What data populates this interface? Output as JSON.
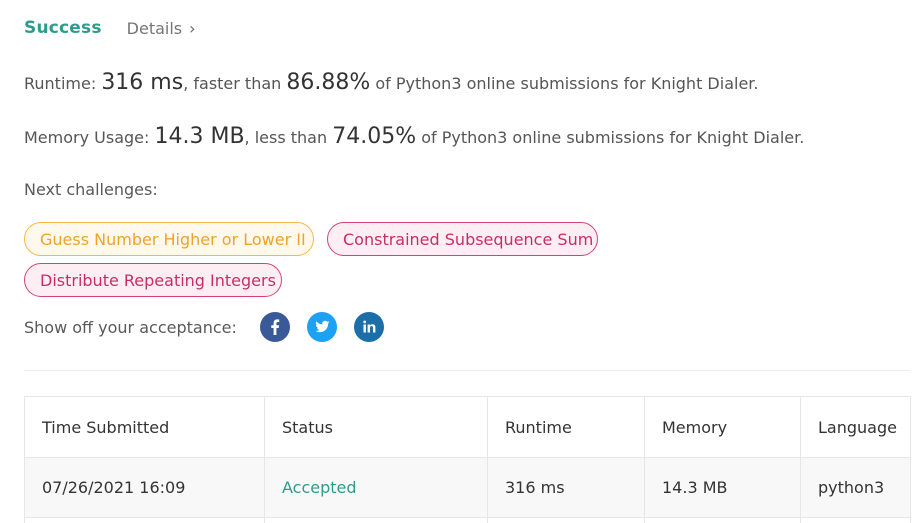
{
  "header": {
    "status": "Success",
    "details_label": "Details",
    "details_chevron": "›"
  },
  "runtime_line": {
    "label": "Runtime: ",
    "value": "316 ms",
    "mid": ", faster than ",
    "percent": "86.88%",
    "suffix": " of Python3 online submissions for Knight Dialer."
  },
  "memory_line": {
    "label": "Memory Usage: ",
    "value": "14.3 MB",
    "mid": ", less than ",
    "percent": "74.05%",
    "suffix": " of Python3 online submissions for Knight Dialer."
  },
  "next_challenges": {
    "label": "Next challenges:",
    "items": [
      {
        "label": "Guess Number Higher or Lower II",
        "difficulty": "medium"
      },
      {
        "label": "Constrained Subsequence Sum",
        "difficulty": "hard"
      },
      {
        "label": "Distribute Repeating Integers",
        "difficulty": "hard"
      }
    ]
  },
  "share": {
    "label": "Show off your acceptance:",
    "icons": [
      "facebook-icon",
      "twitter-icon",
      "linkedin-icon"
    ]
  },
  "table": {
    "headers": [
      "Time Submitted",
      "Status",
      "Runtime",
      "Memory",
      "Language"
    ],
    "rows": [
      {
        "time": "07/26/2021 16:09",
        "status": "Accepted",
        "runtime": "316 ms",
        "memory": "14.3 MB",
        "language": "python3"
      }
    ]
  },
  "colors": {
    "success": "#2e9c8c",
    "medium": "#eea32a",
    "hard": "#c92d66",
    "facebook": "#3a5998",
    "twitter": "#1da1f2",
    "linkedin": "#1b6ea8"
  }
}
